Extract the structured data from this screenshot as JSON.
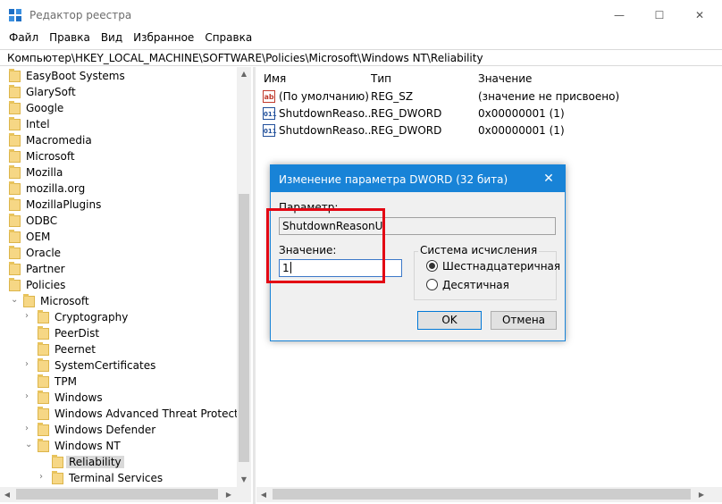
{
  "window": {
    "title": "Редактор реестра",
    "controls": {
      "minimize": "—",
      "maximize": "☐",
      "close": "✕"
    }
  },
  "menu": [
    "Файл",
    "Правка",
    "Вид",
    "Избранное",
    "Справка"
  ],
  "address": "Компьютер\\HKEY_LOCAL_MACHINE\\SOFTWARE\\Policies\\Microsoft\\Windows NT\\Reliability",
  "tree": [
    {
      "label": "EasyBoot Systems",
      "level": 0,
      "expander": ""
    },
    {
      "label": "GlarySoft",
      "level": 0,
      "expander": ""
    },
    {
      "label": "Google",
      "level": 0,
      "expander": ""
    },
    {
      "label": "Intel",
      "level": 0,
      "expander": ""
    },
    {
      "label": "Macromedia",
      "level": 0,
      "expander": ""
    },
    {
      "label": "Microsoft",
      "level": 0,
      "expander": ""
    },
    {
      "label": "Mozilla",
      "level": 0,
      "expander": ""
    },
    {
      "label": "mozilla.org",
      "level": 0,
      "expander": ""
    },
    {
      "label": "MozillaPlugins",
      "level": 0,
      "expander": ""
    },
    {
      "label": "ODBC",
      "level": 0,
      "expander": ""
    },
    {
      "label": "OEM",
      "level": 0,
      "expander": ""
    },
    {
      "label": "Oracle",
      "level": 0,
      "expander": ""
    },
    {
      "label": "Partner",
      "level": 0,
      "expander": ""
    },
    {
      "label": "Policies",
      "level": 0,
      "expander": ""
    },
    {
      "label": "Microsoft",
      "level": 1,
      "expander": "⌄"
    },
    {
      "label": "Cryptography",
      "level": 2,
      "expander": "›"
    },
    {
      "label": "PeerDist",
      "level": 2,
      "expander": ""
    },
    {
      "label": "Peernet",
      "level": 2,
      "expander": ""
    },
    {
      "label": "SystemCertificates",
      "level": 2,
      "expander": "›"
    },
    {
      "label": "TPM",
      "level": 2,
      "expander": ""
    },
    {
      "label": "Windows",
      "level": 2,
      "expander": "›"
    },
    {
      "label": "Windows Advanced Threat Protection",
      "level": 2,
      "expander": ""
    },
    {
      "label": "Windows Defender",
      "level": 2,
      "expander": "›"
    },
    {
      "label": "Windows NT",
      "level": 2,
      "expander": "⌄"
    },
    {
      "label": "Reliability",
      "level": 3,
      "expander": "",
      "selected": true
    },
    {
      "label": "Terminal Services",
      "level": 3,
      "expander": "›"
    }
  ],
  "list": {
    "columns": [
      "Имя",
      "Тип",
      "Значение"
    ],
    "rows": [
      {
        "icon": "string-value-icon",
        "glyph": "ab",
        "name": "(По умолчанию)",
        "type": "REG_SZ",
        "value": "(значение не присвоено)"
      },
      {
        "icon": "binary-value-icon",
        "glyph": "011",
        "name": "ShutdownReaso...",
        "type": "REG_DWORD",
        "value": "0x00000001 (1)"
      },
      {
        "icon": "binary-value-icon",
        "glyph": "011",
        "name": "ShutdownReaso...",
        "type": "REG_DWORD",
        "value": "0x00000001 (1)"
      }
    ]
  },
  "dialog": {
    "title": "Изменение параметра DWORD (32 бита)",
    "close": "✕",
    "param_label": "Параметр:",
    "param_value": "ShutdownReasonUI",
    "value_label": "Значение:",
    "value": "1",
    "base_group": "Система исчисления",
    "base_options": [
      {
        "label": "Шестнадцатеричная",
        "checked": true
      },
      {
        "label": "Десятичная",
        "checked": false
      }
    ],
    "ok": "OK",
    "cancel": "Отмена"
  },
  "colors": {
    "accent": "#1883d7",
    "highlight": "#e30613",
    "folder": "#f6d785"
  }
}
